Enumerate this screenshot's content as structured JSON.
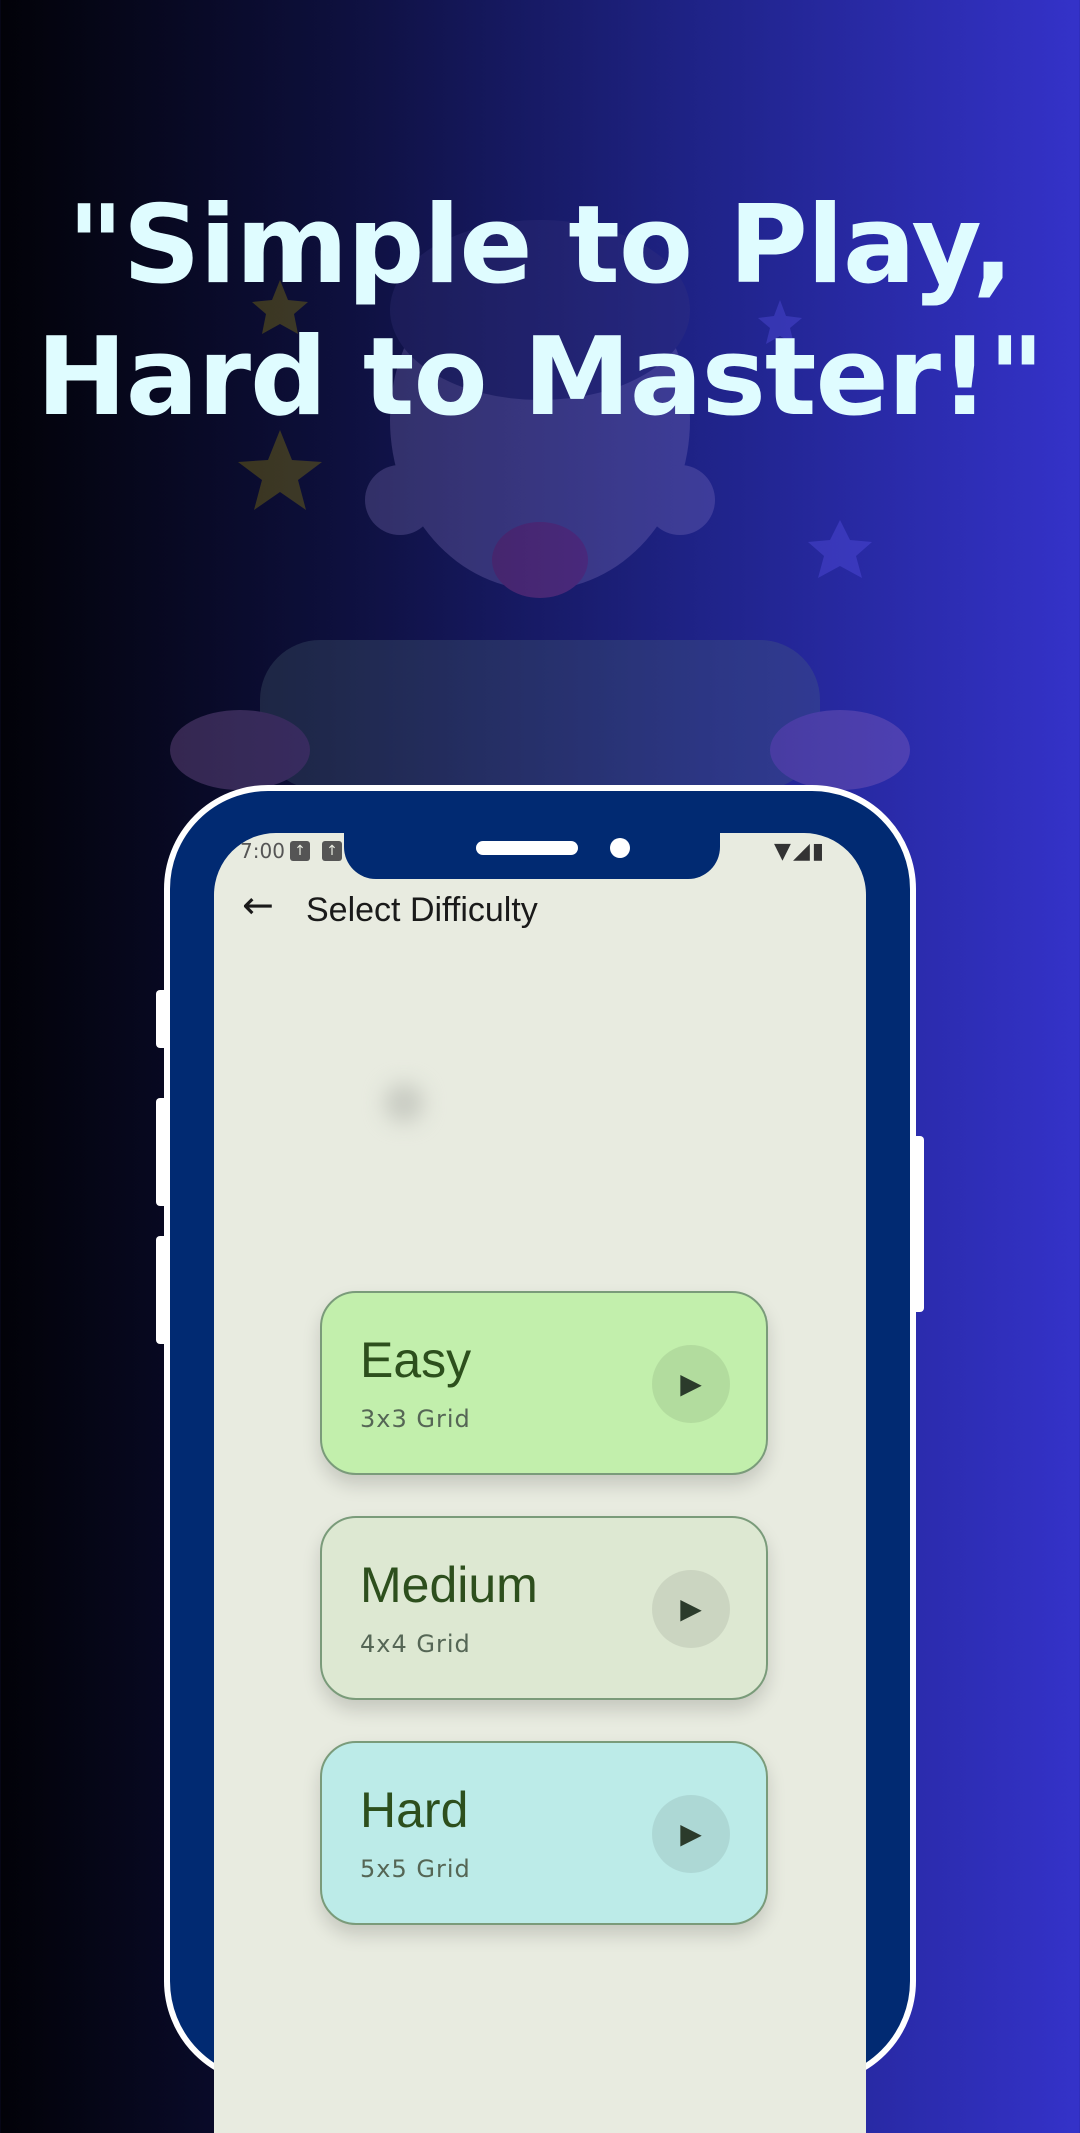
{
  "headline": {
    "line1": "\"Simple to Play,",
    "line2": "Hard to Master!\""
  },
  "status_bar": {
    "time": "7:00",
    "icons": [
      "notification-icon",
      "notification-icon"
    ],
    "right_icons": [
      "wifi-icon",
      "signal-icon",
      "battery-icon"
    ]
  },
  "app_bar": {
    "back_icon": "arrow-left-icon",
    "title": "Select Difficulty"
  },
  "difficulties": [
    {
      "label": "Easy",
      "subtitle": "3x3 Grid",
      "color": "#c2efac"
    },
    {
      "label": "Medium",
      "subtitle": "4x4 Grid",
      "color": "#dde8d2"
    },
    {
      "label": "Hard",
      "subtitle": "5x5 Grid",
      "color": "#bcebe8"
    }
  ],
  "colors": {
    "headline": "#dffcff",
    "phone_frame": "#012a72",
    "screen_bg": "#e8ebe0",
    "card_text": "#2d4f1d"
  }
}
